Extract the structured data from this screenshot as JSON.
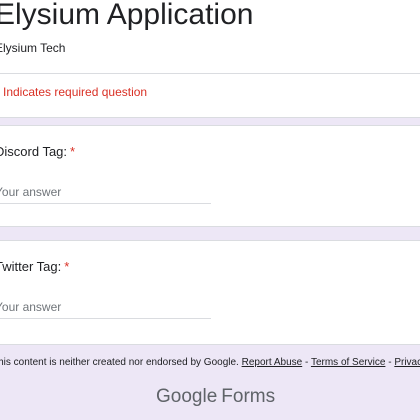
{
  "form": {
    "title": "Elysium Application",
    "organization": "Elysium Tech",
    "required_note": "* Indicates required question"
  },
  "questions": [
    {
      "label": "Discord Tag:",
      "required_mark": "*",
      "placeholder": "Your answer"
    },
    {
      "label": "Twitter Tag:",
      "required_mark": "*",
      "placeholder": "Your answer"
    }
  ],
  "footer": {
    "disclaimer": "This content is neither created nor endorsed by Google.",
    "links": [
      "Report Abuse",
      "Terms of Service",
      "Privacy Policy"
    ],
    "separator": "-"
  },
  "branding": {
    "google": "Google",
    "forms": "Forms"
  },
  "colors": {
    "background": "#ede7f6",
    "required": "#d93025",
    "divider": "#dadce0"
  }
}
